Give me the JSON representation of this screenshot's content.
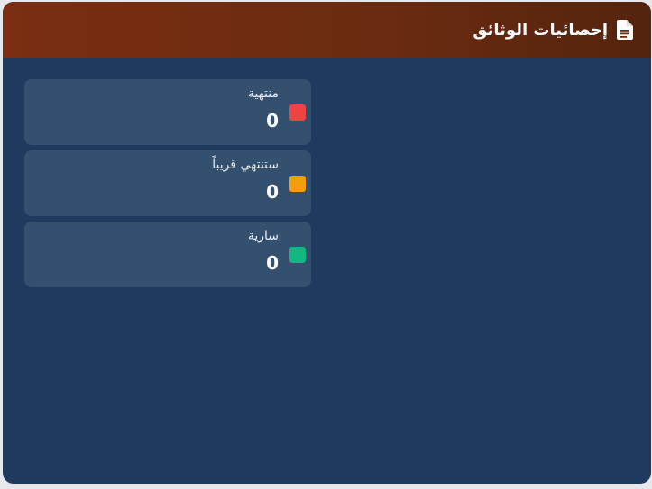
{
  "header": {
    "title": "إحصائيات الوثائق",
    "icon": "document-icon",
    "colors": {
      "start": "#7a2e12",
      "end": "#54240e"
    }
  },
  "panel": {
    "background": "#1f3a5f"
  },
  "stats": [
    {
      "label": "منتهية",
      "value": "0",
      "color": "#ef4444"
    },
    {
      "label": "ستنتهي قريباً",
      "value": "0",
      "color": "#f59e0b"
    },
    {
      "label": "سارية",
      "value": "0",
      "color": "#10b981"
    }
  ]
}
